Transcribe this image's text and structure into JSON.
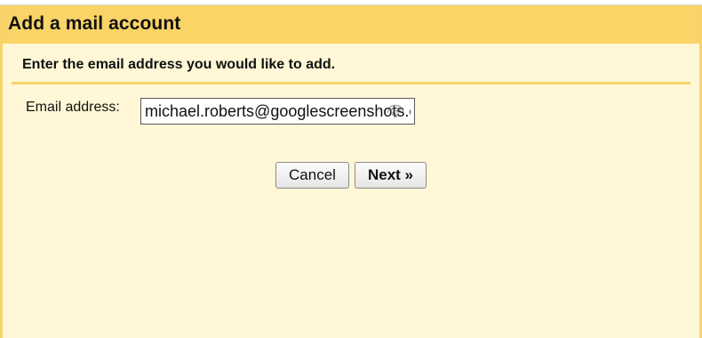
{
  "dialog": {
    "title": "Add a mail account",
    "instruction": "Enter the email address you would like to add.",
    "email_label": "Email address:",
    "email_value": "michael.roberts@googlescreenshots.com",
    "buttons": {
      "cancel_label": "Cancel",
      "next_label": "Next »"
    }
  },
  "colors": {
    "title_bar": "#f9d466",
    "dialog_background": "#fff7d6",
    "accent_border": "#f7d36b"
  },
  "icons": {
    "input_overlay": "fingerprint-icon"
  }
}
